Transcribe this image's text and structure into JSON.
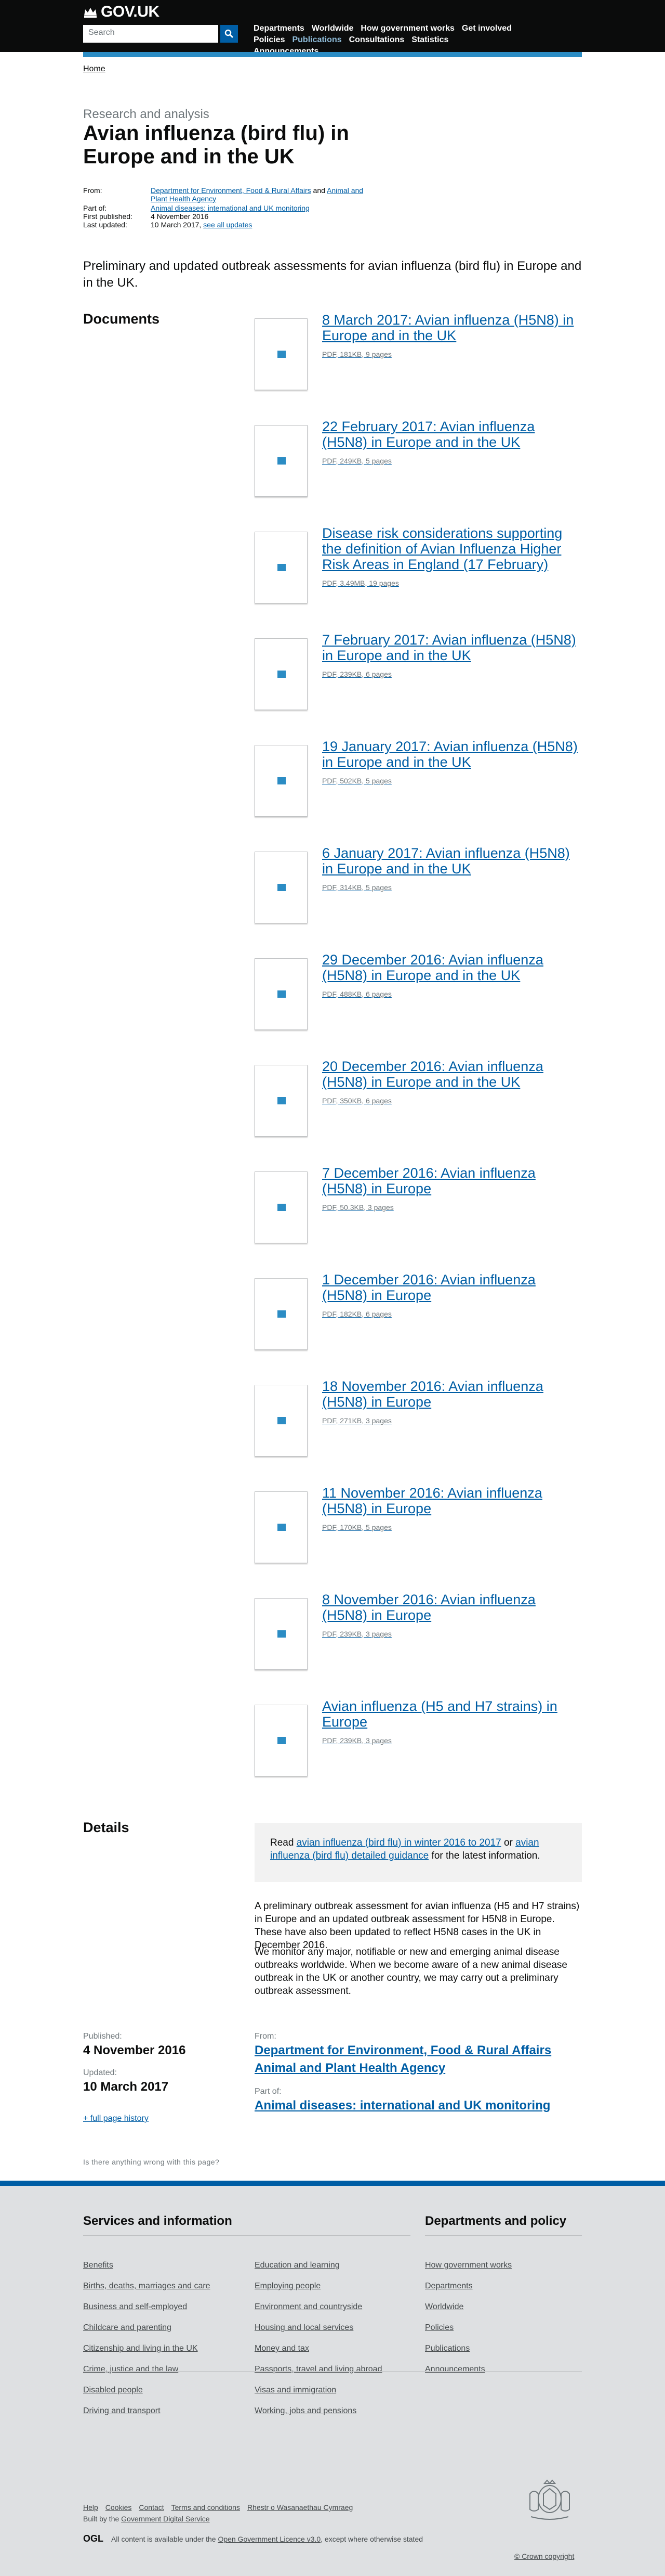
{
  "header": {
    "logo": "GOV.UK",
    "search_placeholder": "Search",
    "nav": [
      "Departments",
      "Worldwide",
      "How government works",
      "Get involved",
      "Policies",
      "Publications",
      "Consultations",
      "Statistics",
      "Announcements"
    ],
    "active_nav": "Publications"
  },
  "breadcrumb": [
    "Home"
  ],
  "page": {
    "kicker": "Research and analysis",
    "title": "Avian influenza (bird flu) in Europe and in the UK",
    "meta": {
      "from_label": "From:",
      "from_value_1": "Department for Environment, Food & Rural Affairs",
      "from_and": " and ",
      "from_value_2": "Animal and Plant Health Agency",
      "partof_label": "Part of:",
      "partof_value": "Animal diseases: international and UK monitoring",
      "firstpub_label": "First published:",
      "firstpub_value": "4 November 2016",
      "updated_label": "Last updated:",
      "updated_value": "10 March 2017, ",
      "updated_link": "see all updates"
    },
    "summary": "Preliminary and updated outbreak assessments for avian influenza (bird flu) in Europe and in the UK."
  },
  "documents": {
    "heading": "Documents",
    "items": [
      {
        "title": "8 March 2017: Avian influenza (H5N8) in Europe and in the UK",
        "meta": "PDF, 181KB, 9 pages"
      },
      {
        "title": "22 February 2017: Avian influenza (H5N8) in Europe and in the UK",
        "meta": "PDF, 249KB, 5 pages"
      },
      {
        "title": "Disease risk considerations supporting the definition of Avian Influenza Higher Risk Areas in England (17 February)",
        "meta": "PDF, 3.49MB, 19 pages"
      },
      {
        "title": "7 February 2017: Avian influenza (H5N8) in Europe and in the UK",
        "meta": "PDF, 239KB, 6 pages"
      },
      {
        "title": "19 January 2017: Avian influenza (H5N8) in Europe and in the UK",
        "meta": "PDF, 502KB, 5 pages"
      },
      {
        "title": "6 January 2017: Avian influenza (H5N8) in Europe and in the UK",
        "meta": "PDF, 314KB, 5 pages"
      },
      {
        "title": "29 December 2016: Avian influenza (H5N8) in Europe and in the UK",
        "meta": "PDF, 488KB, 6 pages"
      },
      {
        "title": "20 December 2016: Avian influenza (H5N8) in Europe and in the UK",
        "meta": "PDF, 350KB, 6 pages"
      },
      {
        "title": "7 December 2016: Avian influenza (H5N8) in Europe",
        "meta": "PDF, 50.3KB, 3 pages"
      },
      {
        "title": "1 December 2016: Avian influenza (H5N8) in Europe",
        "meta": "PDF, 182KB, 6 pages"
      },
      {
        "title": "18 November 2016: Avian influenza (H5N8) in Europe",
        "meta": "PDF, 271KB, 3 pages"
      },
      {
        "title": "11 November 2016: Avian influenza (H5N8) in Europe",
        "meta": "PDF, 170KB, 5 pages"
      },
      {
        "title": "8 November 2016: Avian influenza (H5N8) in Europe",
        "meta": "PDF, 239KB, 3 pages"
      },
      {
        "title": "Avian influenza (H5 and H7 strains) in Europe",
        "meta": "PDF, 239KB, 3 pages"
      }
    ]
  },
  "details": {
    "heading": "Details",
    "notice_read": "Read ",
    "notice_link_1": "avian influenza (bird flu) in winter 2016 to 2017",
    "notice_or": " or ",
    "notice_link_2": "avian influenza (bird flu) detailed guidance",
    "notice_end": " for the latest information.",
    "para_1": "A preliminary outbreak assessment for avian influenza (H5 and H7 strains) in Europe and an updated outbreak assessment for H5N8 in Europe. These have also been updated to reflect H5N8 cases in the UK in December 2016.",
    "para_2": "We monitor any major, notifiable or new and emerging animal disease outbreaks worldwide. When we become aware of a new animal disease outbreak in the UK or another country, we may carry out a preliminary outbreak assessment."
  },
  "published": {
    "published_label": "Published:",
    "published_value": "4 November 2016",
    "updated_label": "Updated:",
    "updated_value": "10 March 2017",
    "full_history": "+ full page history",
    "from_label": "From:",
    "from_1": "Department for Environment, Food & Rural Affairs",
    "from_2": "Animal and Plant Health Agency",
    "partof_label": "Part of:",
    "partof_value": "Animal diseases: international and UK monitoring",
    "is_there": "Is there anything wrong with this page?"
  },
  "footer": {
    "services_heading": "Services and information",
    "departments_heading": "Departments and policy",
    "col1": [
      "Benefits",
      "Births, deaths, marriages and care",
      "Business and self-employed",
      "Childcare and parenting",
      "Citizenship and living in the UK",
      "Crime, justice and the law",
      "Disabled people",
      "Driving and transport"
    ],
    "col2": [
      "Education and learning",
      "Employing people",
      "Environment and countryside",
      "Housing and local services",
      "Money and tax",
      "Passports, travel and living abroad",
      "Visas and immigration",
      "Working, jobs and pensions"
    ],
    "col3": [
      "How government works",
      "Departments",
      "Worldwide",
      "Policies",
      "Publications",
      "Announcements"
    ],
    "bottom_links": [
      "Help",
      "Cookies",
      "Contact",
      "Terms and conditions",
      "Rhestr o Wasanaethau Cymraeg"
    ],
    "built_by": "Built by the ",
    "built_by_link": "Government Digital Service",
    "ogl": "OGL",
    "license_1": "All content is available under the ",
    "license_link": "Open Government Licence v3.0",
    "license_2": ", except where otherwise stated",
    "copyright": "© Crown copyright"
  }
}
